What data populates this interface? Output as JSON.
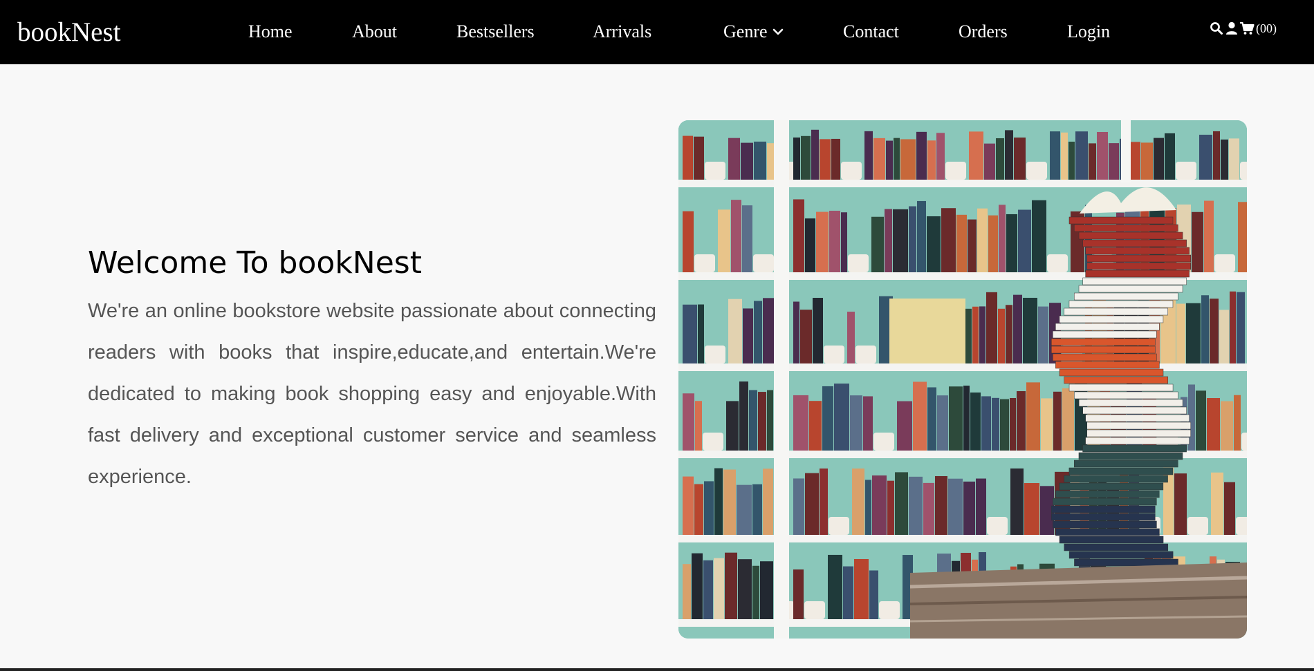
{
  "brand": "bookNest",
  "nav": {
    "home": "Home",
    "about": "About",
    "bestsellers": "Bestsellers",
    "arrivals": "Arrivals",
    "genre": "Genre",
    "contact": "Contact",
    "orders": "Orders",
    "login": "Login"
  },
  "icons": {
    "search": "search-icon",
    "user": "user-icon",
    "cart": "cart-icon",
    "cart_count": "(00)"
  },
  "hero": {
    "title": "Welcome To bookNest",
    "text": "We're an online bookstore website passionate about connecting readers with books that inspire,educate,and entertain.We're dedicated to making book shopping easy and enjoyable.With fast delivery and exceptional customer service and seamless experience."
  },
  "colors": {
    "navbar_bg": "#000000",
    "page_bg": "#f8f8f8",
    "text_muted": "#555555",
    "shelf_wall": "#88c4b7"
  }
}
